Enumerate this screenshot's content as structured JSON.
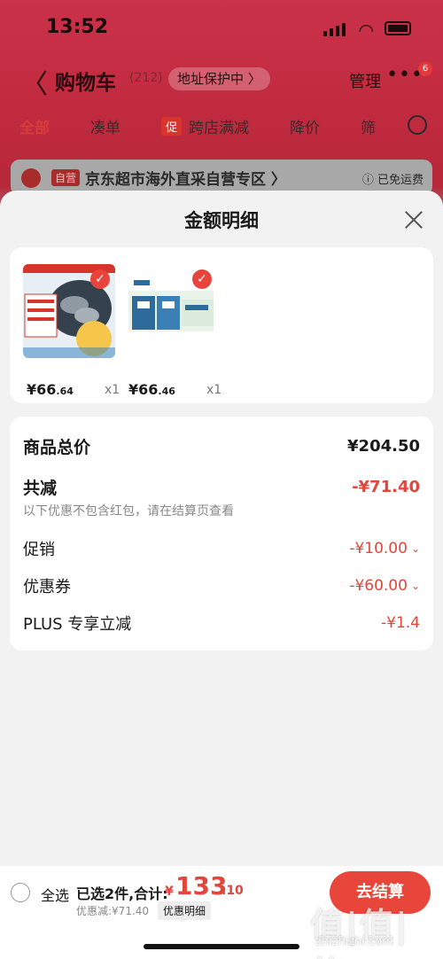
{
  "status": {
    "time": "13:52"
  },
  "nav": {
    "back": "〈",
    "title": "购物车",
    "count": "(212)",
    "address": "地址保护中 〉",
    "manage": "管理",
    "more": "•••",
    "badge": "6"
  },
  "tabs": {
    "all": "全部",
    "combine": "凑单",
    "promo_tag": "促",
    "cross_store": "跨店满减",
    "price_drop": "降价",
    "filter": "筛"
  },
  "store": {
    "self_tag": "自营",
    "name": "京东超市海外直采自营专区 〉",
    "shipping": "ⓘ 已免运费"
  },
  "sheet": {
    "title": "金额明细",
    "goods": [
      {
        "price_int": "¥66",
        "price_dec": ".64",
        "qty": "x1",
        "image": "seafood-product"
      },
      {
        "price_int": "¥66",
        "price_dec": ".46",
        "qty": "x1",
        "image": "milk-box-product"
      }
    ],
    "summary": {
      "subtotal_label": "商品总价",
      "subtotal_value": "¥204.50",
      "discount_label": "共减",
      "discount_value": "-¥71.40",
      "note": "以下优惠不包含红包，请在结算页查看",
      "promo_label": "促销",
      "promo_value": "-¥10.00",
      "coupon_label": "优惠券",
      "coupon_value": "-¥60.00",
      "plus_label": "PLUS 专享立减",
      "plus_value": "-¥1.4"
    }
  },
  "bar": {
    "select_all": "全选",
    "chosen": "已选2件,合计:",
    "currency": "¥",
    "total_int": "133",
    "total_dec": ".10",
    "discount": "优惠减:¥71.40",
    "detail": "优惠明细",
    "checkout": "去结算"
  },
  "watermark": {
    "main": "值|值|值",
    "sub": "zhizhizhi.com"
  },
  "colors": {
    "accent": "#e2453a",
    "brand_bg": "#c9324a"
  }
}
